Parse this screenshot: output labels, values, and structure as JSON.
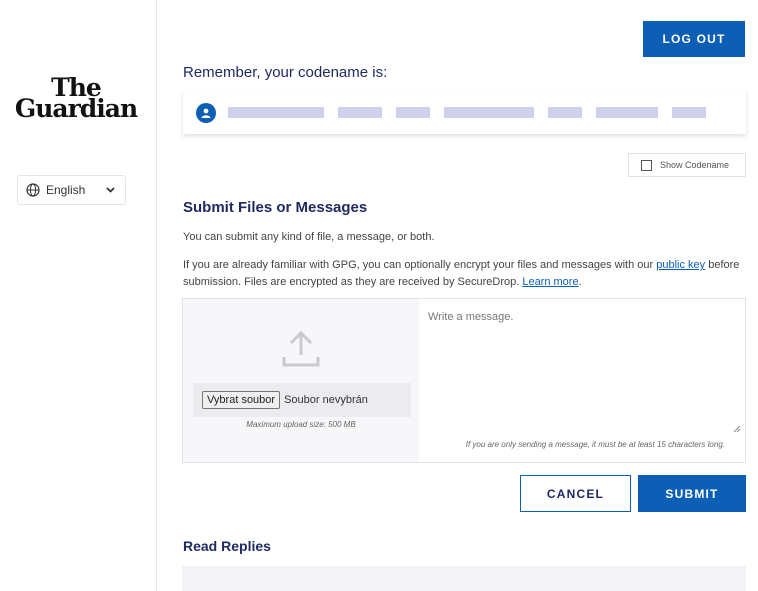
{
  "brand": {
    "logo_line1": "The",
    "logo_line2": "Guardian"
  },
  "language": {
    "selected": "English",
    "icon": "globe-icon"
  },
  "header": {
    "logout_label": "LOG OUT"
  },
  "codename": {
    "heading": "Remember, your codename is:",
    "show_label": "Show Codename",
    "show_checked": false,
    "avatar_icon": "user-icon",
    "mask_color": "#cfd1ec"
  },
  "submit_section": {
    "title": "Submit Files or Messages",
    "intro": "You can submit any kind of file, a message, or both.",
    "gpg_text_1": "If you are already familiar with GPG, you can optionally encrypt your files and messages with our ",
    "public_key_link": "public key",
    "gpg_text_2": " before submission. Files are encrypted as they are received by SecureDrop. ",
    "learn_more_link": "Learn more",
    "gpg_text_3": ".",
    "file": {
      "button_label": "Vybrat soubor",
      "status": "Soubor nevybrán",
      "max_size": "Maximum upload size: 500 MB",
      "icon": "upload-icon"
    },
    "message": {
      "placeholder": "Write a message.",
      "note": "If you are only sending a message, it must be at least 15 characters long."
    },
    "cancel_label": "CANCEL",
    "submit_label": "SUBMIT"
  },
  "replies": {
    "title": "Read Replies"
  },
  "colors": {
    "primary": "#0c5fb5",
    "heading": "#1f2a63"
  }
}
